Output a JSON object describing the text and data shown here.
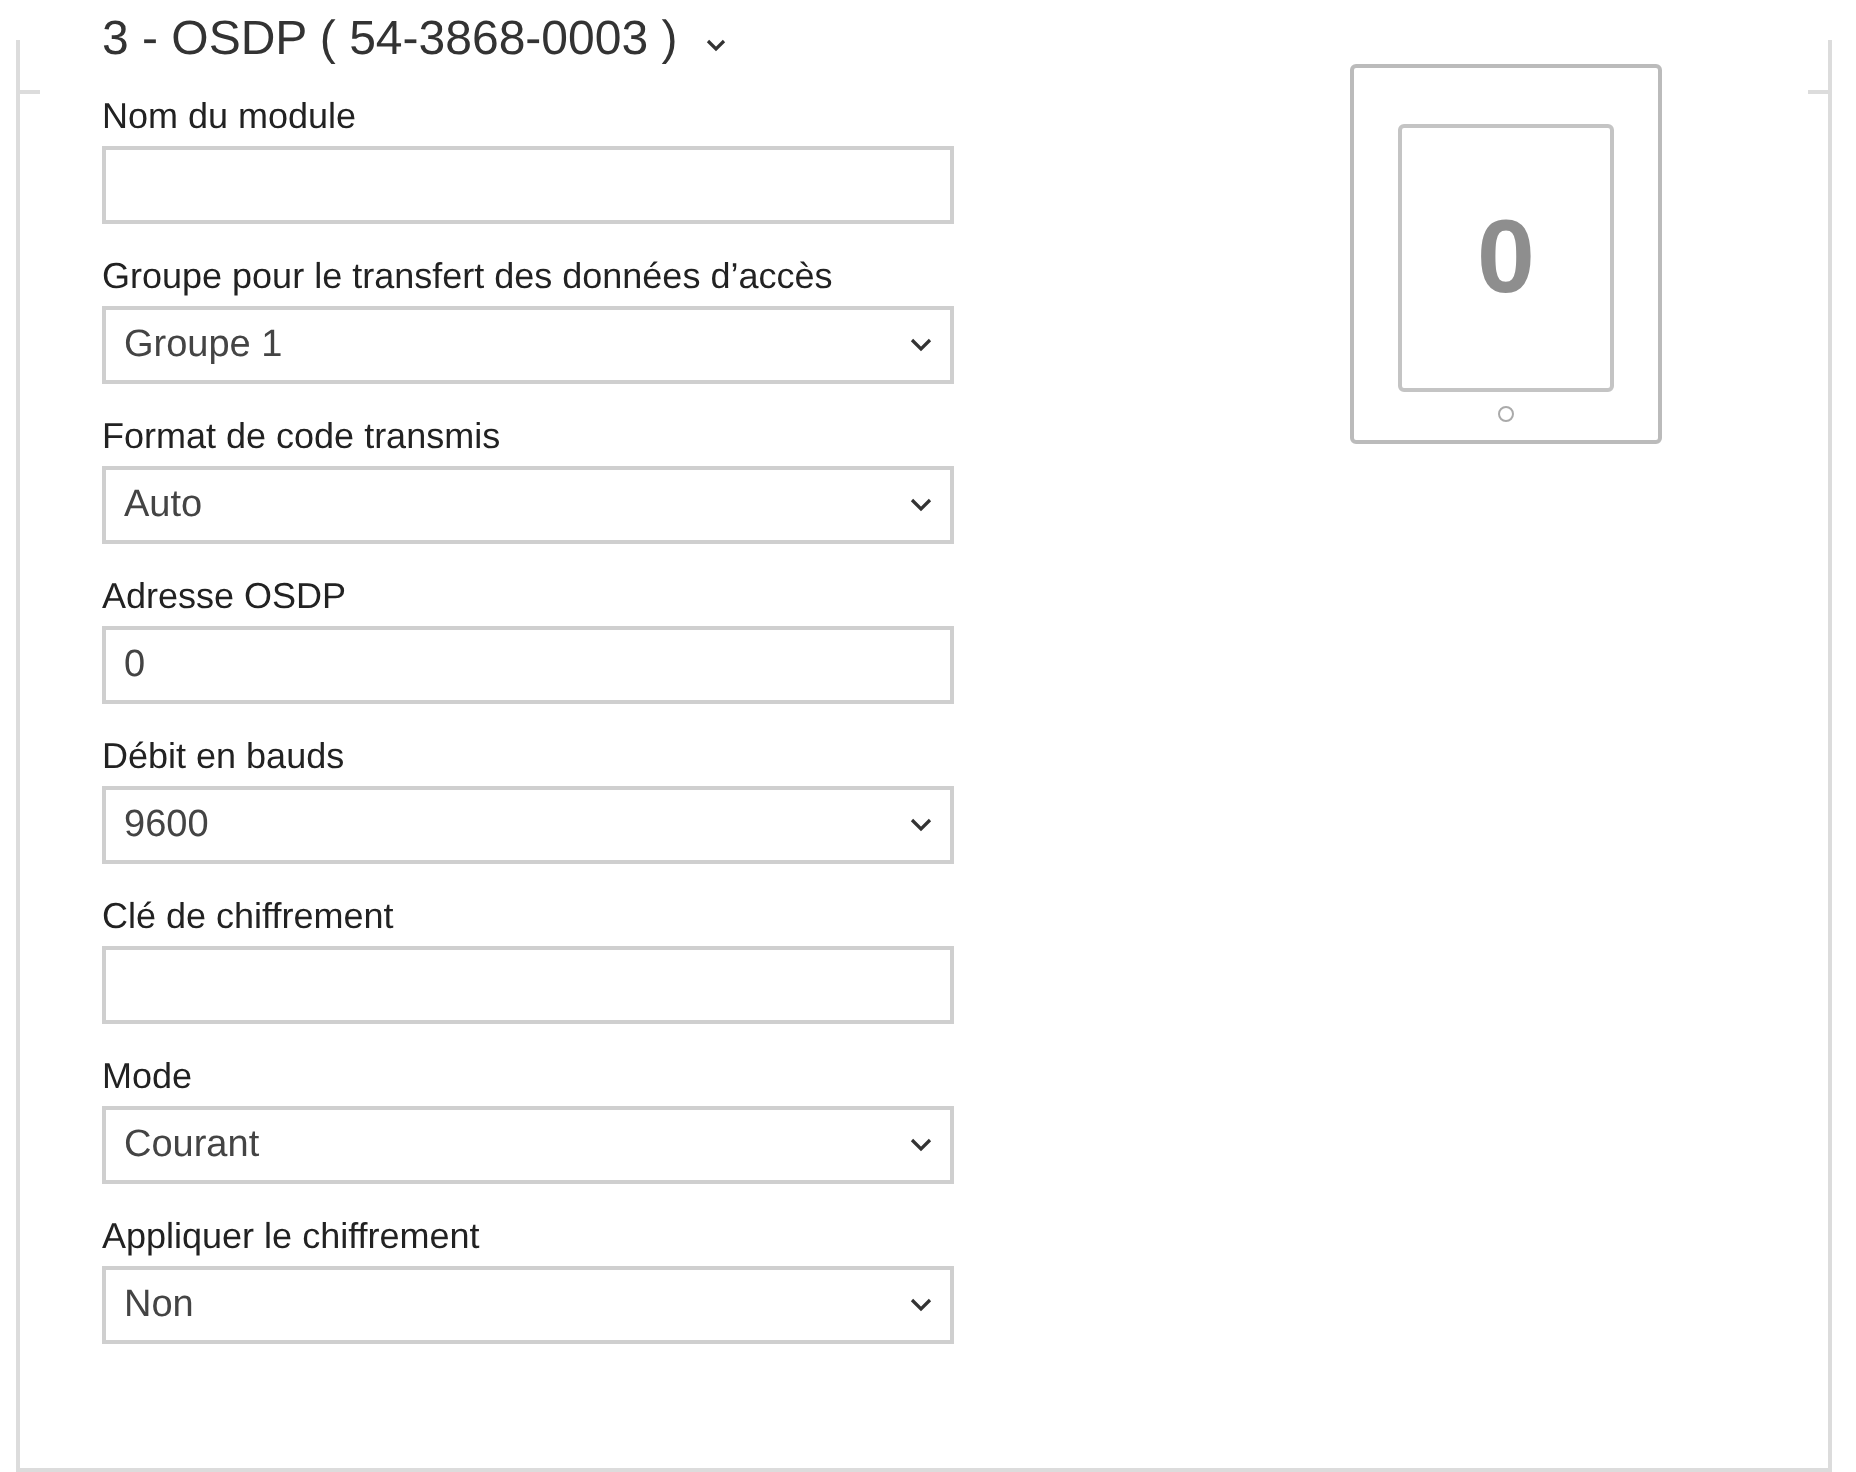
{
  "section": {
    "title": "3 - OSDP ( 54-3868-0003 )",
    "expanded": true
  },
  "fields": [
    {
      "label": "Nom du module",
      "kind": "text"
    },
    {
      "label": "Groupe pour le transfert des données d’accès",
      "kind": "select",
      "value": "Groupe 1"
    },
    {
      "label": "Format de code transmis",
      "kind": "select",
      "value": "Auto"
    },
    {
      "label": "Adresse OSDP",
      "kind": "text",
      "value": "0"
    },
    {
      "label": "Débit en bauds",
      "kind": "select",
      "value": "9600"
    },
    {
      "label": "Clé de chiffrement",
      "kind": "text"
    },
    {
      "label": "Mode",
      "kind": "select",
      "value": "Courant"
    },
    {
      "label": "Appliquer le chiffrement",
      "kind": "select",
      "value": "Non"
    }
  ],
  "device": {
    "display": "0"
  }
}
